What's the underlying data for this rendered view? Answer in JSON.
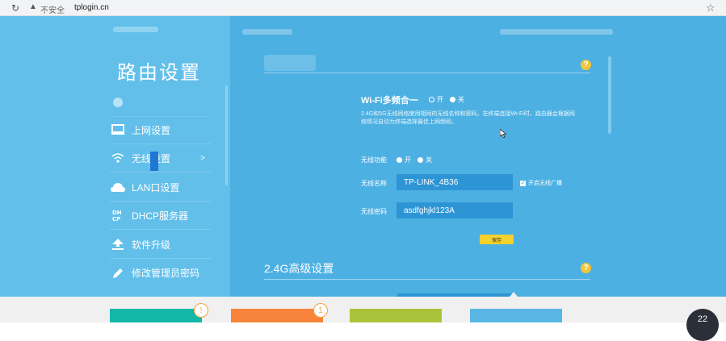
{
  "browser": {
    "reload_icon": "↻",
    "security_icon": "▲",
    "security_text": "不安全",
    "url": "tplogin.cn",
    "bookmark_icon": "☆"
  },
  "sidebar": {
    "title": "路由设置",
    "items": [
      {
        "label": "",
        "icon": "blurred-icon"
      },
      {
        "label": "上网设置",
        "icon": "monitor-icon"
      },
      {
        "label": "无线设置",
        "icon": "wifi-icon",
        "arrow": ">"
      },
      {
        "label": "LAN口设置",
        "icon": "cloud-icon"
      },
      {
        "label": "DHCP服务器",
        "icon": "dhcp-icon"
      },
      {
        "label": "软件升级",
        "icon": "upload-icon"
      },
      {
        "label": "修改管理员密码",
        "icon": "pencil-icon"
      }
    ]
  },
  "wireless": {
    "help": "?",
    "merge_label": "Wi-Fi多频合一",
    "merge_on": "开",
    "merge_off": "关",
    "description": "2.4G和5G无线网络使用相同的无线名称和密码，在终端连接Wi-Fi时，路由器会根据网络情况自动为终端选择最佳上网频段。",
    "func_label": "无线功能",
    "func_on": "开",
    "func_off": "关",
    "ssid_label": "无线名称",
    "ssid_value": "TP-LINK_4B36",
    "broadcast_label": "开启无线广播",
    "broadcast_checked": "✓",
    "password_label": "无线密码",
    "password_value": "asdfghjkl123A",
    "save_label": "保存"
  },
  "advanced": {
    "title": "2.4G高级设置",
    "help": "?"
  },
  "bottom": {
    "badges": [
      "!",
      "1"
    ],
    "speed": "22"
  },
  "colors": {
    "accent": "#4db0e2",
    "sidebar": "#62bfea",
    "save": "#f5d12c",
    "tile1": "#13b7a7",
    "tile2": "#f7843a",
    "tile3": "#a9c43a",
    "tile4": "#5ab7e5"
  }
}
